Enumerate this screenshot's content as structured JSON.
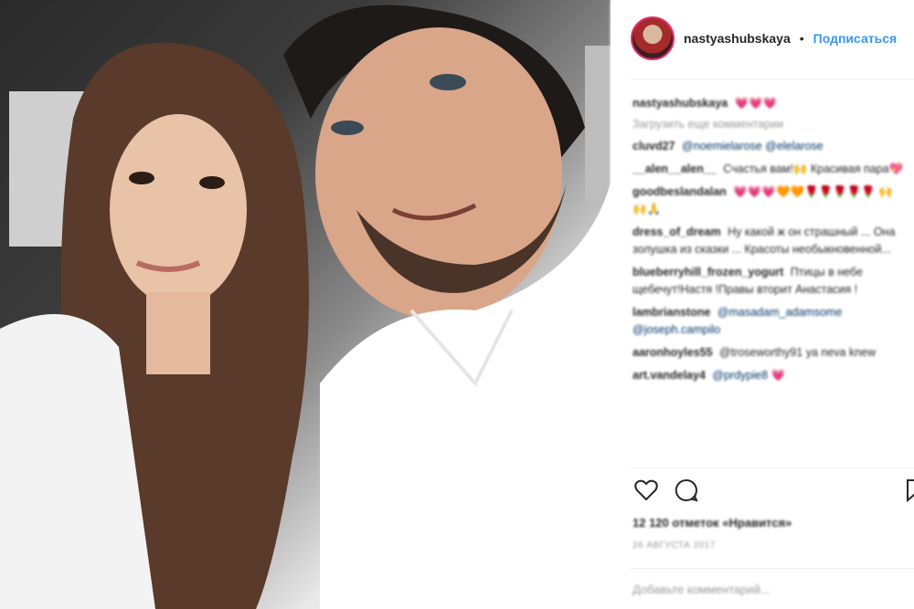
{
  "post": {
    "username": "nastyashubskaya",
    "dot": "•",
    "follow_label": "Подписаться"
  },
  "comments": {
    "caption": {
      "user": "nastyashubskaya",
      "text": "💗💗💗"
    },
    "load_more": "Загрузить еще комментарии",
    "items": [
      {
        "user": "cluvd27",
        "text": "@noemielarose @elelarose"
      },
      {
        "user": "__alen__alen__",
        "text": "Счастья вам!🙌 Красивая пара💖"
      },
      {
        "user": "goodbeslandalan",
        "text": "💗💗💗🧡🧡🌹🌹🌹🌹🌹 🙌🙌🙏"
      },
      {
        "user": "dress_of_dream",
        "text": "Ну какой ж он страшный ... Она золушка из сказки ... Красоты необыкновенной..."
      },
      {
        "user": "blueberryhill_frozen_yogurt",
        "text": "Птицы в небе щебечут!Настя !Правы вторит Анастасия !"
      },
      {
        "user": "lambrianstone",
        "text": "@masadam_adamsome @joseph.campilo"
      },
      {
        "user": "aaronhoyles55",
        "text": "@troseworthy91 ya neva knew"
      },
      {
        "user": "art.vandelay4",
        "text": "@prdypie8 💗"
      }
    ]
  },
  "footer": {
    "likes": "12 120 отметок «Нравится»",
    "date": "26 АВГУСТА 2017",
    "add_comment_placeholder": "Добавьте комментарий..."
  },
  "icons": {
    "heart": "heart-icon",
    "comment": "comment-icon",
    "save": "bookmark-icon"
  },
  "colors": {
    "follow": "#3897f0",
    "avatar_ring": "#e1306c"
  }
}
